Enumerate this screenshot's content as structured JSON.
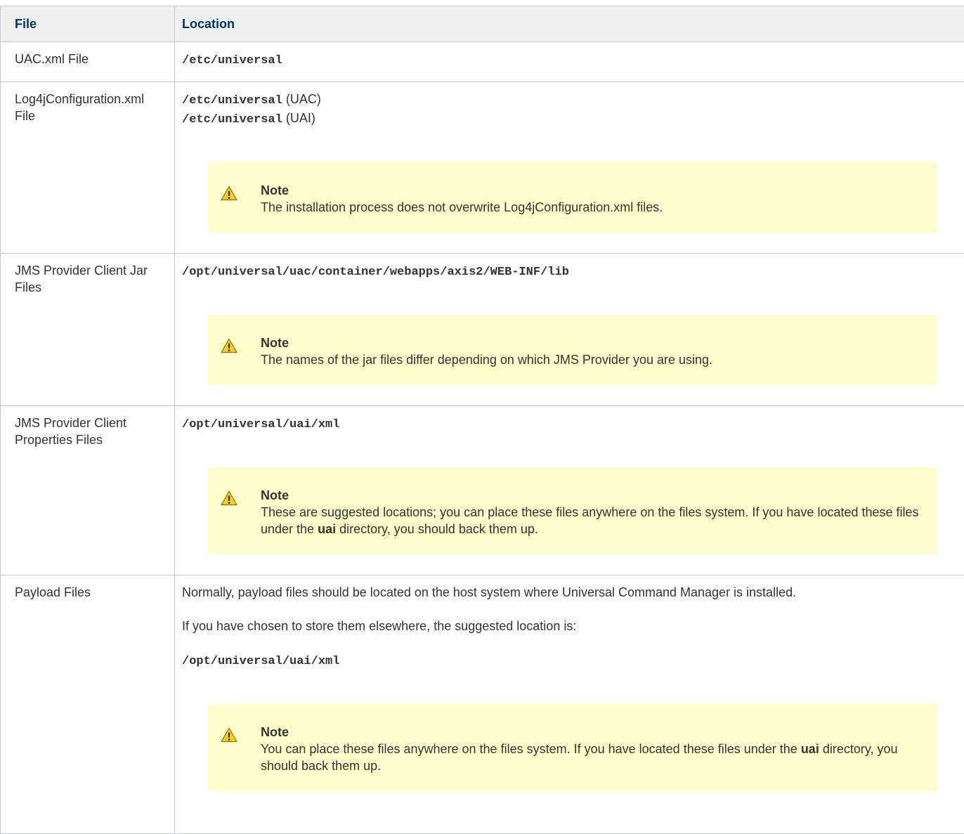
{
  "headers": {
    "file": "File",
    "location": "Location"
  },
  "rows": [
    {
      "file": "UAC.xml File",
      "path": "/etc/universal"
    },
    {
      "file": "Log4jConfiguration.xml File",
      "path1": "/etc/universal",
      "suffix1": "(UAC)",
      "path2": "/etc/universal",
      "suffix2": "(UAI)",
      "note": {
        "title": "Note",
        "text": "The installation process does not overwrite Log4jConfiguration.xml files."
      }
    },
    {
      "file": "JMS Provider Client Jar Files",
      "path": "/opt/universal/uac/container/webapps/axis2/WEB-INF/lib",
      "note": {
        "title": "Note",
        "text": "The names of the jar files differ depending on which JMS Provider you are using."
      }
    },
    {
      "file": "JMS Provider Client Properties Files",
      "path": "/opt/universal/uai/xml",
      "note": {
        "title": "Note",
        "text_before": "These are suggested locations; you can place these files anywhere on the files system. If you have located these files under the",
        "bold": "uai",
        "text_after": "directory, you should back them up."
      }
    },
    {
      "file": "Payload Files",
      "para1": "Normally, payload files should be located on the host system where Universal Command Manager is installed.",
      "para2": "If you have chosen to store them elsewhere, the suggested location is:",
      "path": "/opt/universal/uai/xml",
      "note": {
        "title": "Note",
        "text_before": "You can place these files anywhere on the files system. If you have located these files under the",
        "bold": "uai",
        "text_after": "directory, you should back them up."
      }
    }
  ],
  "icons": {
    "warning": "warning-icon",
    "warning_color": "#f5c400"
  }
}
